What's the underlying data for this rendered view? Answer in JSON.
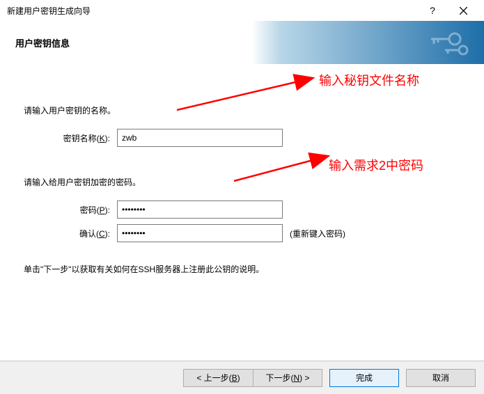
{
  "titlebar": {
    "title": "新建用户密钥生成向导"
  },
  "banner": {
    "title": "用户密钥信息"
  },
  "content": {
    "prompt1": "请输入用户密钥的名称。",
    "keyname_label": "密钥名称(K):",
    "keyname_value": "zwb",
    "prompt2": "请输入给用户密钥加密的密码。",
    "password_label": "密码(P):",
    "password_value": "••••••••",
    "confirm_label": "确认(C):",
    "confirm_value": "••••••••",
    "confirm_hint": "(重新键入密码)",
    "footnote": "单击\"下一步\"以获取有关如何在SSH服务器上注册此公钥的说明。"
  },
  "annotations": {
    "a1": "输入秘钥文件名称",
    "a2": "输入需求2中密码"
  },
  "footer": {
    "back": "< 上一步(B)",
    "next": "下一步(N) >",
    "finish": "完成",
    "cancel": "取消"
  }
}
